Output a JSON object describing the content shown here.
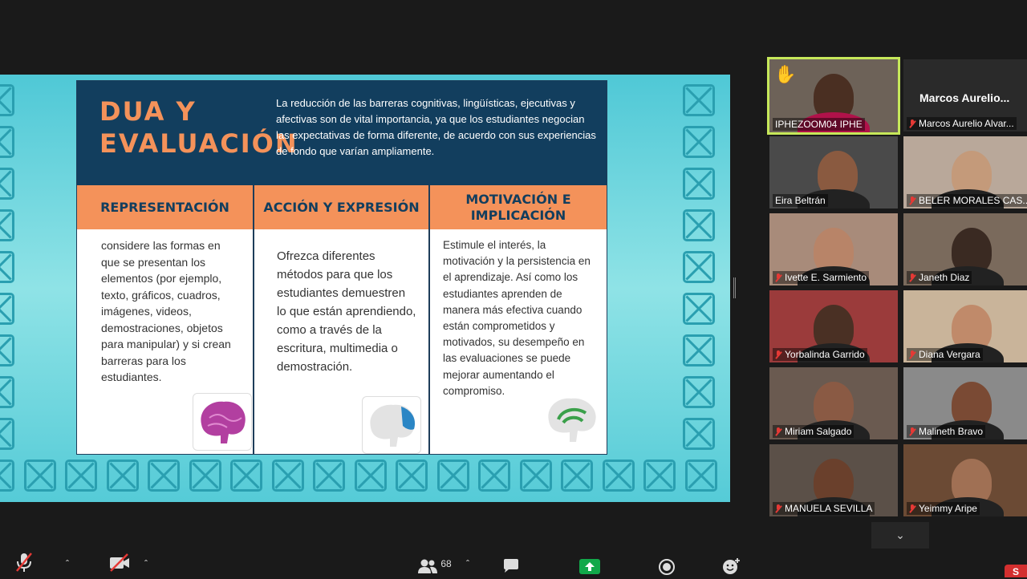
{
  "slide": {
    "title": "DUA Y EVALUACIÓN",
    "intro": "La reducción de las barreras cognitivas, lingüísticas, ejecutivas y afectivas son de vital importancia, ya que los estudiantes negocian las expectativas de forma diferente, de acuerdo con sus experiencias de fondo que varían ampliamente.",
    "columns": [
      {
        "heading": "REPRESENTACIÓN",
        "body": "considere las formas en que se presentan los elementos (por ejemplo, texto, gráficos, cuadros, imágenes, videos, demostraciones, objetos para manipular) y si crean barreras para los estudiantes."
      },
      {
        "heading": "ACCIÓN Y EXPRESIÓN",
        "body": "Ofrezca diferentes métodos para que los estudiantes demuestren lo que están aprendiendo, como a través de la escritura, multimedia o demostración."
      },
      {
        "heading": "MOTIVACIÓN E IMPLICACIÓN",
        "body": "Estimule el interés, la motivación y la persistencia en el aprendizaje. Así como los estudiantes aprenden de manera más efectiva cuando están comprometidos y motivados, su desempeño en las evaluaciones se puede mejorar aumentando el compromiso."
      }
    ]
  },
  "participants": [
    {
      "name": "IPHEZOOM04 IPHE",
      "muted": false,
      "hand": true,
      "active": true
    },
    {
      "name": "Marcos Aurelio Alvar...",
      "display": "Marcos  Aurelio...",
      "muted": true
    },
    {
      "name": "Eira Beltrán",
      "muted": false
    },
    {
      "name": "BELER MORALES CAS...",
      "muted": true
    },
    {
      "name": "Ivette E. Sarmiento",
      "muted": true
    },
    {
      "name": "Janeth Diaz",
      "muted": true
    },
    {
      "name": "Yorbalinda Garrido",
      "muted": true
    },
    {
      "name": "Diana Vergara",
      "muted": true
    },
    {
      "name": "Miriam Salgado",
      "muted": true
    },
    {
      "name": "Malineth Bravo",
      "muted": true
    },
    {
      "name": "MANUELA SEVILLA",
      "muted": true
    },
    {
      "name": "Yeimmy Aripe",
      "muted": true
    }
  ],
  "toolbar": {
    "participants_count": "68",
    "share_label": "S"
  },
  "colors": {
    "accent_orange": "#f4925a",
    "navy": "#123e5e",
    "teal": "#4fc8d6",
    "zoom_green": "#12a84a"
  }
}
